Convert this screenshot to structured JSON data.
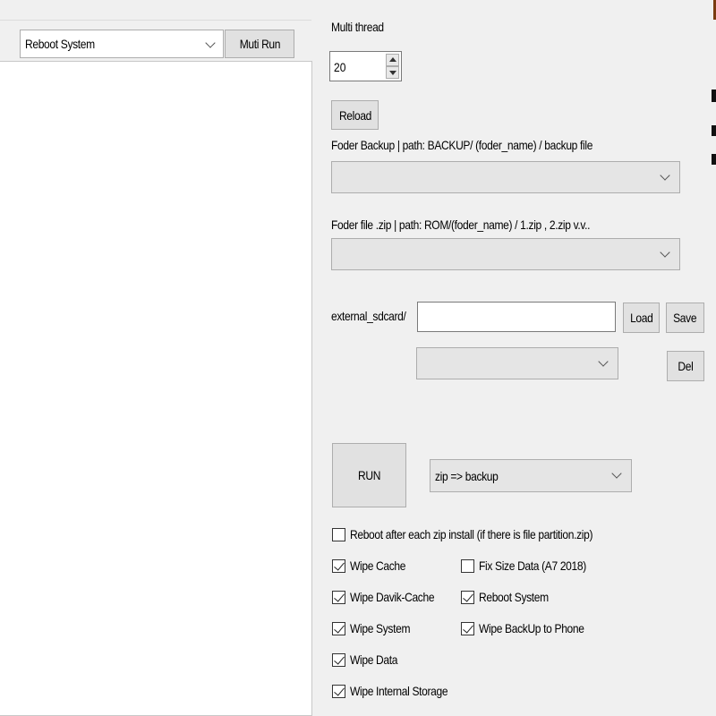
{
  "left_panel": {
    "action_select": {
      "value": "Reboot System"
    },
    "multi_run_button": "Muti Run"
  },
  "multi_thread": {
    "label": "Multi thread",
    "value": "20"
  },
  "reload_button": "Reload",
  "backup_folder": {
    "label": "Foder Backup | path: BACKUP/ (foder_name) / backup file",
    "value": ""
  },
  "zip_folder": {
    "label": "Foder file .zip | path: ROM/(foder_name) / 1.zip , 2.zip v.v..",
    "value": ""
  },
  "sdcard": {
    "label": "external_sdcard/",
    "input_value": "",
    "load_button": "Load",
    "save_button": "Save",
    "select_value": "",
    "del_button": "Del"
  },
  "run_button": "RUN",
  "mode_select": {
    "value": "zip => backup"
  },
  "options": {
    "reboot_after_zip": {
      "label": "Reboot after each zip install (if there is file partition.zip)",
      "checked": false
    },
    "wipe_cache": {
      "label": "Wipe Cache",
      "checked": true
    },
    "fix_size_data": {
      "label": "Fix Size Data (A7 2018)",
      "checked": false
    },
    "wipe_davik_cache": {
      "label": "Wipe Davik-Cache",
      "checked": true
    },
    "reboot_system": {
      "label": "Reboot System",
      "checked": true
    },
    "wipe_system": {
      "label": "Wipe System",
      "checked": true
    },
    "wipe_backup_to_phone": {
      "label": "Wipe BackUp to Phone",
      "checked": true
    },
    "wipe_data": {
      "label": "Wipe Data",
      "checked": true
    },
    "wipe_internal_storage": {
      "label": "Wipe Internal Storage",
      "checked": true
    }
  }
}
